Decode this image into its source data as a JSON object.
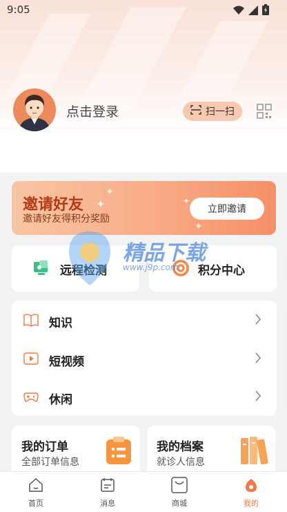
{
  "status_bar": {
    "time": "9:05"
  },
  "header": {
    "login_text": "点击登录",
    "scan_label": "扫一扫"
  },
  "banner": {
    "title": "邀请好友",
    "subtitle": "邀请好友得积分奖励",
    "button": "立即邀请"
  },
  "quick_cards": [
    {
      "label": "远程检测",
      "icon": "monitor-icon"
    },
    {
      "label": "积分中心",
      "icon": "points-icon"
    }
  ],
  "list_items": [
    {
      "label": "知识",
      "icon": "book-icon"
    },
    {
      "label": "短视频",
      "icon": "video-icon"
    },
    {
      "label": "休闲",
      "icon": "gamepad-icon"
    }
  ],
  "bottom_cards": [
    {
      "title": "我的订单",
      "subtitle": "全部订单信息",
      "icon": "clipboard-icon"
    },
    {
      "title": "我的档案",
      "subtitle": "就诊人信息",
      "icon": "files-icon"
    }
  ],
  "watermark": {
    "title": "精品下载",
    "url": "www.j9p.com"
  },
  "tabs": [
    {
      "label": "首页",
      "icon": "home-icon",
      "active": false
    },
    {
      "label": "消息",
      "icon": "message-icon",
      "active": false
    },
    {
      "label": "商城",
      "icon": "shop-icon",
      "active": false
    },
    {
      "label": "我的",
      "icon": "profile-icon",
      "active": true
    }
  ],
  "colors": {
    "accent": "#f07a45",
    "banner_title": "#b33a16",
    "scan_bg": "#f7c9b0"
  }
}
